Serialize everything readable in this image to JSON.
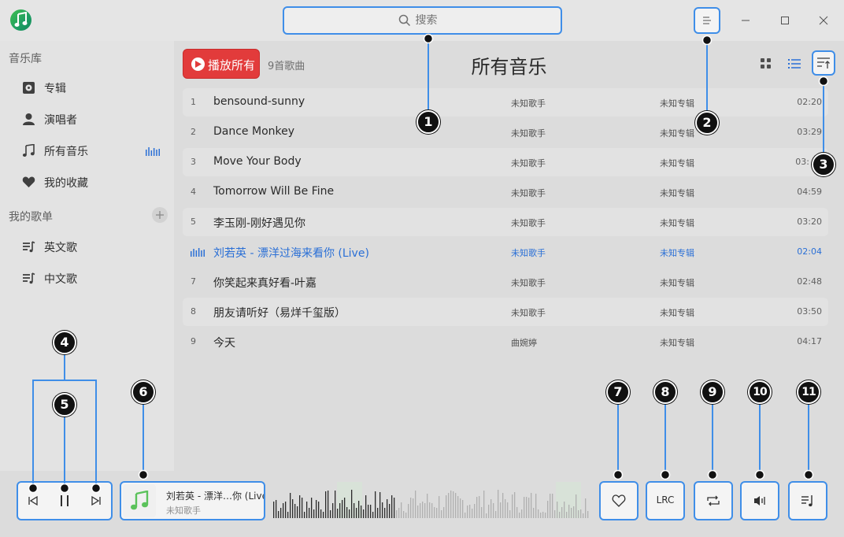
{
  "titlebar": {
    "search_placeholder": "搜索"
  },
  "sidebar": {
    "library_title": "音乐库",
    "library_items": [
      {
        "label": "专辑",
        "icon": "album-icon"
      },
      {
        "label": "演唱者",
        "icon": "artist-icon"
      },
      {
        "label": "所有音乐",
        "icon": "music-note-icon",
        "active": true
      },
      {
        "label": "我的收藏",
        "icon": "heart-icon"
      }
    ],
    "playlists_title": "我的歌单",
    "playlists": [
      {
        "label": "英文歌",
        "icon": "playlist-icon"
      },
      {
        "label": "中文歌",
        "icon": "playlist-icon"
      }
    ]
  },
  "main": {
    "play_all_label": "播放所有",
    "song_count": "9首歌曲",
    "title": "所有音乐",
    "songs": [
      {
        "num": "1",
        "title": "bensound-sunny",
        "artist": "未知歌手",
        "album": "未知专辑",
        "duration": "02:20"
      },
      {
        "num": "2",
        "title": "Dance Monkey",
        "artist": "未知歌手",
        "album": "未知专辑",
        "duration": "03:29"
      },
      {
        "num": "3",
        "title": "Move Your Body",
        "artist": "未知歌手",
        "album": "未知专辑",
        "duration": "03:"
      },
      {
        "num": "4",
        "title": "Tomorrow Will Be Fine",
        "artist": "未知歌手",
        "album": "未知专辑",
        "duration": "04:59"
      },
      {
        "num": "5",
        "title": "李玉刚-刚好遇见你",
        "artist": "未知歌手",
        "album": "未知专辑",
        "duration": "03:20"
      },
      {
        "num": "",
        "title": "刘若英 - 漂洋过海来看你 (Live)",
        "artist": "未知歌手",
        "album": "未知专辑",
        "duration": "02:04",
        "playing": true
      },
      {
        "num": "7",
        "title": "你笑起来真好看-叶嘉",
        "artist": "未知歌手",
        "album": "未知专辑",
        "duration": "02:48"
      },
      {
        "num": "8",
        "title": "朋友请听好（易烊千玺版）",
        "artist": "未知歌手",
        "album": "未知专辑",
        "duration": "03:50"
      },
      {
        "num": "9",
        "title": "今天",
        "artist": "曲婉婷",
        "album": "未知专辑",
        "duration": "04:17"
      }
    ]
  },
  "player": {
    "now_playing_title": "刘若英 - 漂洋…你 (Live)",
    "now_playing_artist": "未知歌手",
    "lyrics_label": "LRC"
  },
  "callouts": [
    "1",
    "2",
    "3",
    "4",
    "5",
    "6",
    "7",
    "8",
    "9",
    "10",
    "11"
  ],
  "colors": {
    "accent": "#3f8ee8",
    "play_all": "#e23b3b",
    "active_song": "#2a6fd6",
    "callout": "#111111"
  }
}
